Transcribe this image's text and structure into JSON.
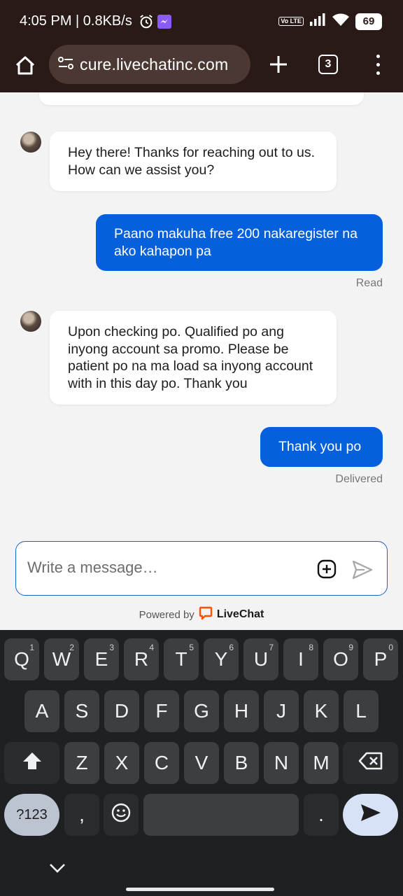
{
  "status_bar": {
    "time": "4:05 PM | 0.8KB/s",
    "volte": "Vo LTE",
    "battery": "69"
  },
  "browser": {
    "url": "cure.livechatinc.com",
    "tab_count": "3"
  },
  "messages": [
    {
      "from": "agent",
      "text": "Hey there! Thanks for reaching out to us. How can we assist you?"
    },
    {
      "from": "user",
      "text": "Paano makuha free 200 nakaregister na ako kahapon pa",
      "receipt": "Read"
    },
    {
      "from": "agent",
      "text": "Upon checking po. Qualified po ang inyong account sa promo. Please be patient po na ma load sa inyong account with in this day po. Thank you"
    },
    {
      "from": "user",
      "text": "Thank you po",
      "receipt": "Delivered"
    }
  ],
  "composer": {
    "placeholder": "Write a message…"
  },
  "powered_by": {
    "prefix": "Powered by",
    "brand": "LiveChat",
    "brand_color": "#ff5100"
  },
  "keyboard": {
    "row1": [
      {
        "k": "Q",
        "n": "1"
      },
      {
        "k": "W",
        "n": "2"
      },
      {
        "k": "E",
        "n": "3"
      },
      {
        "k": "R",
        "n": "4"
      },
      {
        "k": "T",
        "n": "5"
      },
      {
        "k": "Y",
        "n": "6"
      },
      {
        "k": "U",
        "n": "7"
      },
      {
        "k": "I",
        "n": "8"
      },
      {
        "k": "O",
        "n": "9"
      },
      {
        "k": "P",
        "n": "0"
      }
    ],
    "row2": [
      "A",
      "S",
      "D",
      "F",
      "G",
      "H",
      "J",
      "K",
      "L"
    ],
    "row3": [
      "Z",
      "X",
      "C",
      "V",
      "B",
      "N",
      "M"
    ],
    "symbols_label": "?123",
    "comma": ",",
    "period": "."
  },
  "colors": {
    "accent": "#0560dc",
    "topbar": "#2a1a17"
  }
}
